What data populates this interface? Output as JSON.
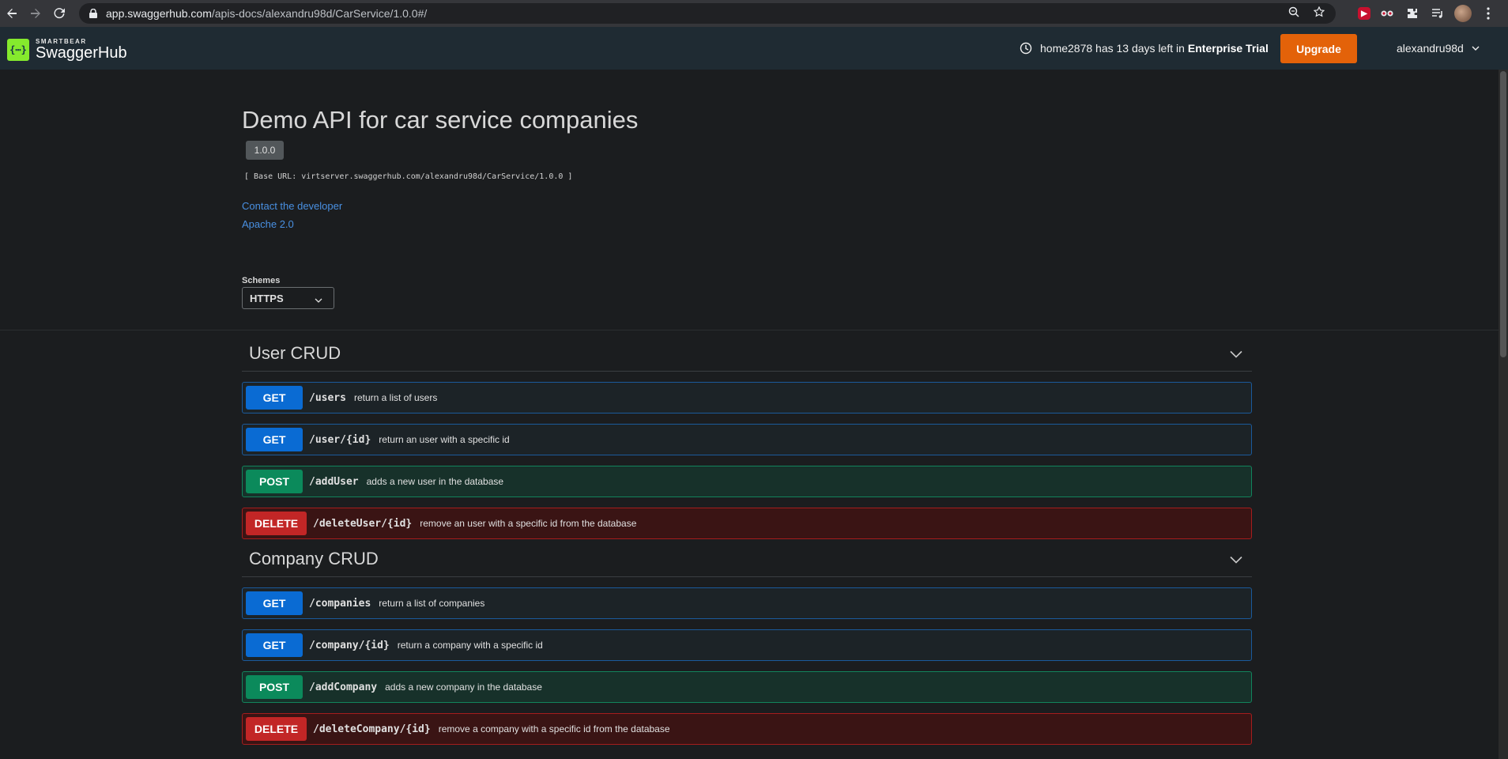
{
  "browser": {
    "url_host": "app.swaggerhub.com",
    "url_path": "/apis-docs/alexandru98d/CarService/1.0.0#/"
  },
  "header": {
    "logo_small": "SMARTBEAR",
    "logo_big": "SwaggerHub",
    "trial_prefix": "home2878 has 13 days left in",
    "trial_plan": "Enterprise Trial",
    "upgrade_label": "Upgrade",
    "username": "alexandru98d"
  },
  "info": {
    "title": "Demo API for car service companies",
    "version": "1.0.0",
    "base_url": "[ Base URL: virtserver.swaggerhub.com/alexandru98d/CarService/1.0.0 ]",
    "contact_link": "Contact the developer",
    "license_link": "Apache 2.0",
    "schemes_label": "Schemes",
    "schemes_value": "HTTPS"
  },
  "groups": [
    {
      "title": "User CRUD",
      "ops": [
        {
          "method": "GET",
          "path": "/users",
          "summary": "return a list of users"
        },
        {
          "method": "GET",
          "path": "/user/{id}",
          "summary": "return an user with a specific id"
        },
        {
          "method": "POST",
          "path": "/addUser",
          "summary": "adds a new user in the database"
        },
        {
          "method": "DELETE",
          "path": "/deleteUser/{id}",
          "summary": "remove an user with a specific id from the database"
        }
      ]
    },
    {
      "title": "Company CRUD",
      "ops": [
        {
          "method": "GET",
          "path": "/companies",
          "summary": "return a list of companies"
        },
        {
          "method": "GET",
          "path": "/company/{id}",
          "summary": "return a company with a specific id"
        },
        {
          "method": "POST",
          "path": "/addCompany",
          "summary": "adds a new company in the database"
        },
        {
          "method": "DELETE",
          "path": "/deleteCompany/{id}",
          "summary": "remove a company with a specific id from the database"
        }
      ]
    }
  ],
  "colors": {
    "get": "#0a6bd3",
    "post": "#0b8a5b",
    "delete": "#c22626",
    "upgrade": "#e36209",
    "link": "#4990e2"
  },
  "icons": [
    "back-icon",
    "forward-icon",
    "reload-icon",
    "lock-icon",
    "zoom-icon",
    "star-icon",
    "extension-icon",
    "playlist-icon",
    "menu-icon",
    "clock-icon",
    "chevron-down-icon"
  ]
}
